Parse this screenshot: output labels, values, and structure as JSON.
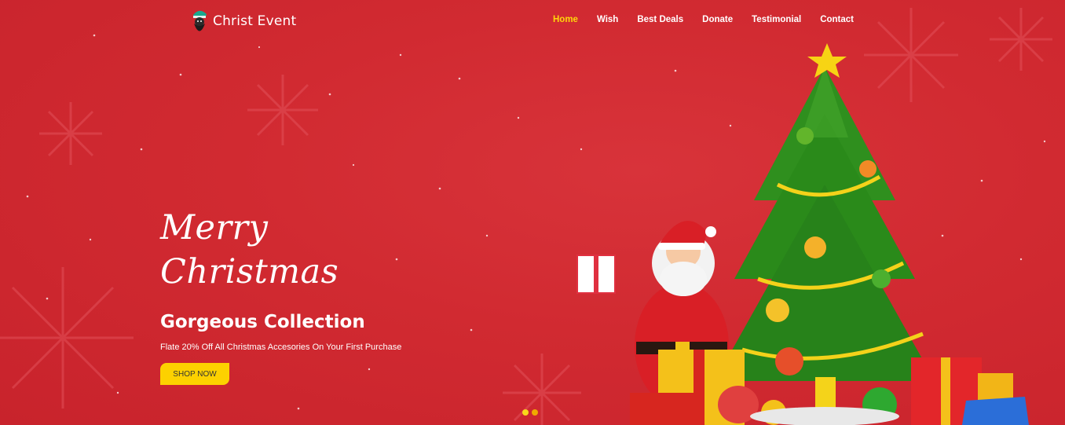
{
  "header": {
    "brand": "Christ Event",
    "nav": [
      {
        "label": "Home",
        "active": true
      },
      {
        "label": "Wish",
        "active": false
      },
      {
        "label": "Best Deals",
        "active": false
      },
      {
        "label": "Donate",
        "active": false
      },
      {
        "label": "Testimonial",
        "active": false
      },
      {
        "label": "Contact",
        "active": false
      }
    ]
  },
  "hero": {
    "script_line1": "Merry",
    "script_line2": "Christmas",
    "headline": "Gorgeous Collection",
    "subline": "Flate 20% Off All Christmas Accesories On Your First Purchase",
    "cta": "SHOP NOW"
  },
  "slider": {
    "slides": 2,
    "current": 1
  },
  "colors": {
    "background": "#d12a31",
    "nav_active": "#ffd60a",
    "cta_bg": "#fdd100",
    "text": "#ffffff"
  },
  "icons": [
    "santa-logo-icon",
    "snowflake-icon"
  ]
}
